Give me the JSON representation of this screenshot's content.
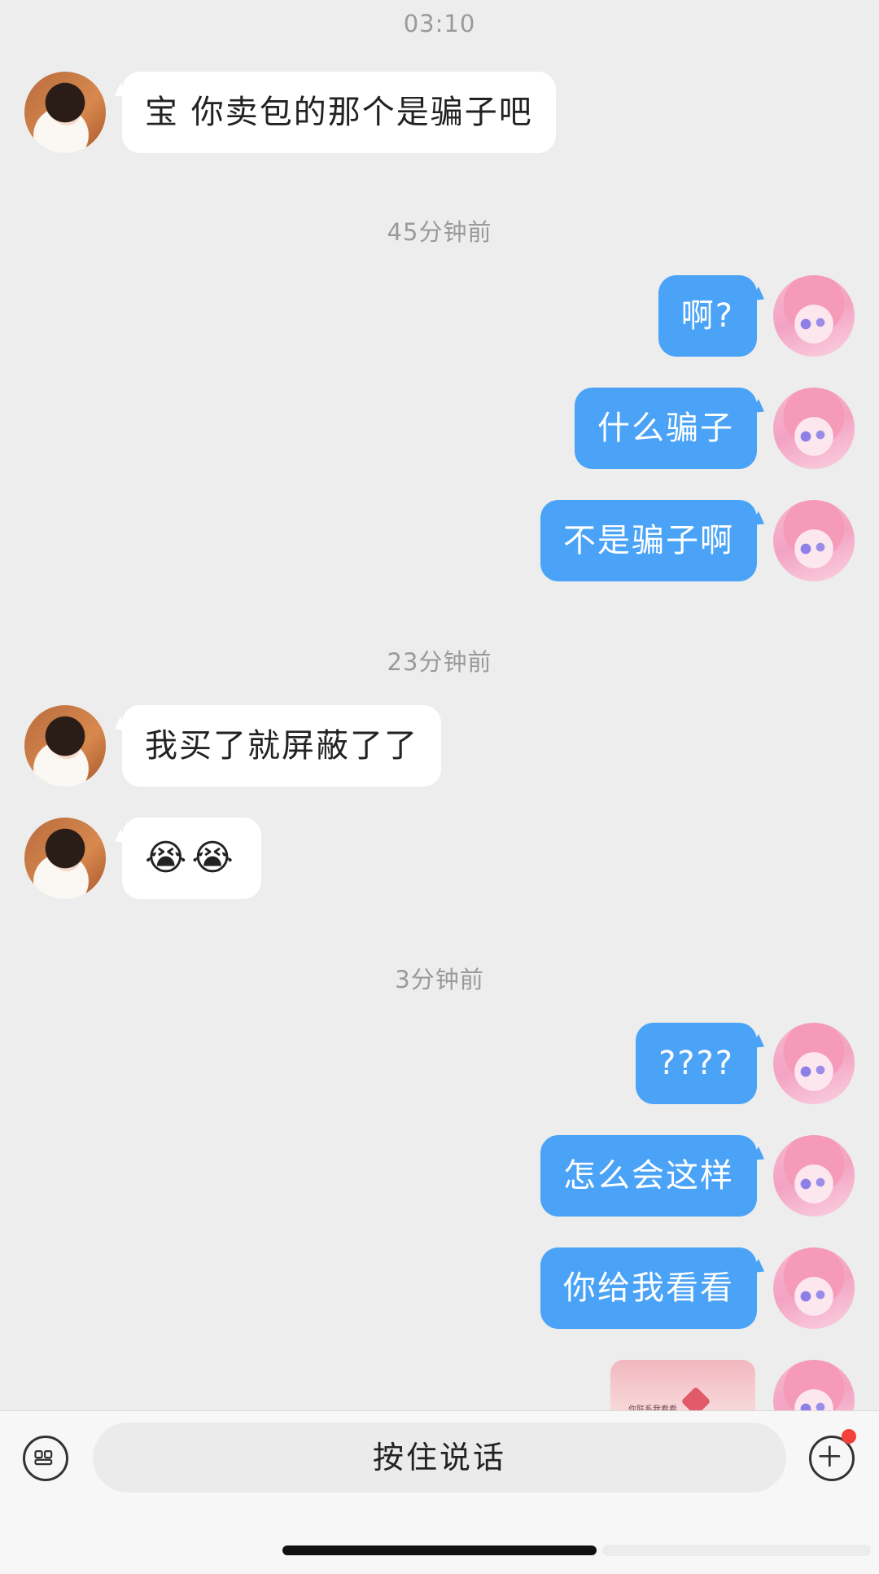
{
  "chat": {
    "timestamps": {
      "t1": "03:10",
      "t2": "45分钟前",
      "t3": "23分钟前",
      "t4": "3分钟前"
    },
    "messages": [
      {
        "side": "other",
        "text": "宝 你卖包的那个是骗子吧"
      },
      {
        "side": "self",
        "text": "啊?"
      },
      {
        "side": "self",
        "text": "什么骗子"
      },
      {
        "side": "self",
        "text": "不是骗子啊"
      },
      {
        "side": "other",
        "text": "我买了就屏蔽了了"
      },
      {
        "side": "other",
        "text": "😭😭"
      },
      {
        "side": "self",
        "text": "????"
      },
      {
        "side": "self",
        "text": "怎么会这样"
      },
      {
        "side": "self",
        "text": "你给我看看"
      }
    ],
    "image_message": {
      "caption": "你联系我看看"
    }
  },
  "bottom_bar": {
    "hold_to_talk_label": "按住说话",
    "voice_toggle_icon": "keyboard-icon",
    "plus_icon": "plus-circle-icon",
    "notification_color": "#f2423a"
  },
  "colors": {
    "background": "#ededed",
    "self_bubble": "#4aa3f7",
    "other_bubble": "#ffffff",
    "timestamp_text": "#9a9a9a"
  }
}
